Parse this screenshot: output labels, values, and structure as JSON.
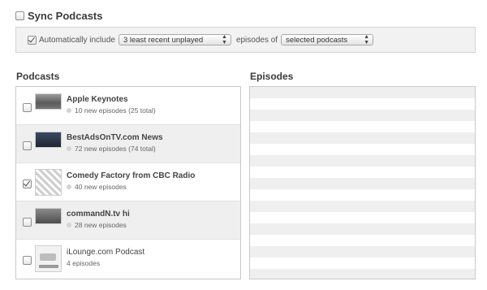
{
  "sync": {
    "title": "Sync Podcasts",
    "enabled": false,
    "auto_include_label": "Automatically include",
    "auto_include_checked": true,
    "count_select_value": "3 least recent unplayed",
    "episodes_of_label": "episodes of",
    "podcasts_select_value": "selected podcasts"
  },
  "podcasts": {
    "heading": "Podcasts",
    "items": [
      {
        "title": "Apple Keynotes",
        "detail": "10 new episodes (25 total)",
        "checked": false,
        "thumb_color": "#5a5a5a"
      },
      {
        "title": "BestAdsOnTV.com News",
        "detail": "72 new episodes (74 total)",
        "checked": false,
        "thumb_color": "#2f3a4d"
      },
      {
        "title": "Comedy Factory from CBC Radio",
        "detail": "40 new episodes",
        "checked": true,
        "thumb_color": "#777777"
      },
      {
        "title": "commandN.tv hi",
        "detail": "28 new episodes",
        "checked": false,
        "thumb_color": "#4d4d4d"
      },
      {
        "title": "iLounge.com Podcast",
        "detail": "4 episodes",
        "checked": false,
        "thumb_color": "#e8e8e8"
      }
    ]
  },
  "episodes": {
    "heading": "Episodes"
  }
}
